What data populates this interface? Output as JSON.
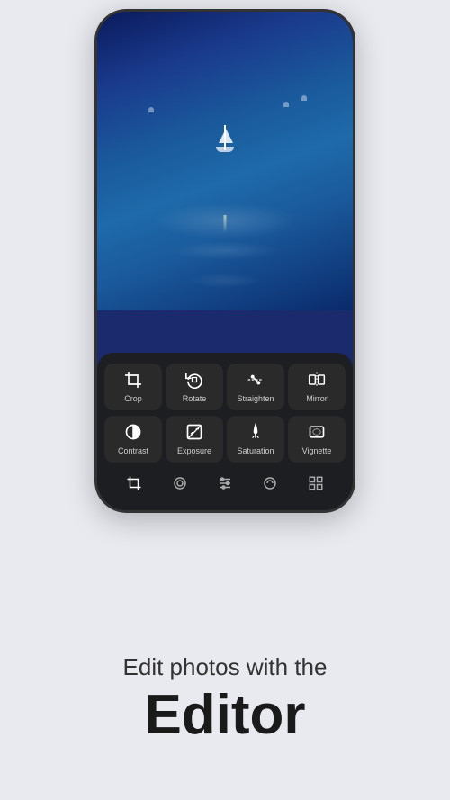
{
  "background_color": "#e8eaf0",
  "phone": {
    "tools_row1": [
      {
        "id": "crop",
        "label": "Crop",
        "icon": "crop"
      },
      {
        "id": "rotate",
        "label": "Rotate",
        "icon": "rotate"
      },
      {
        "id": "straighten",
        "label": "Straighten",
        "icon": "straighten"
      },
      {
        "id": "mirror",
        "label": "Mirror",
        "icon": "mirror"
      }
    ],
    "tools_row2": [
      {
        "id": "contrast",
        "label": "Contrast",
        "icon": "contrast"
      },
      {
        "id": "exposure",
        "label": "Exposure",
        "icon": "exposure"
      },
      {
        "id": "saturation",
        "label": "Saturation",
        "icon": "saturation"
      },
      {
        "id": "vignette",
        "label": "Vignette",
        "icon": "vignette"
      }
    ],
    "bottom_tabs": [
      {
        "id": "crop-tab",
        "active": true
      },
      {
        "id": "filter-tab",
        "active": false
      },
      {
        "id": "adjust-tab",
        "active": false
      },
      {
        "id": "color-tab",
        "active": false
      },
      {
        "id": "grid-tab",
        "active": false
      }
    ]
  },
  "text": {
    "subtitle": "Edit photos with the",
    "main_title": "Editor"
  }
}
